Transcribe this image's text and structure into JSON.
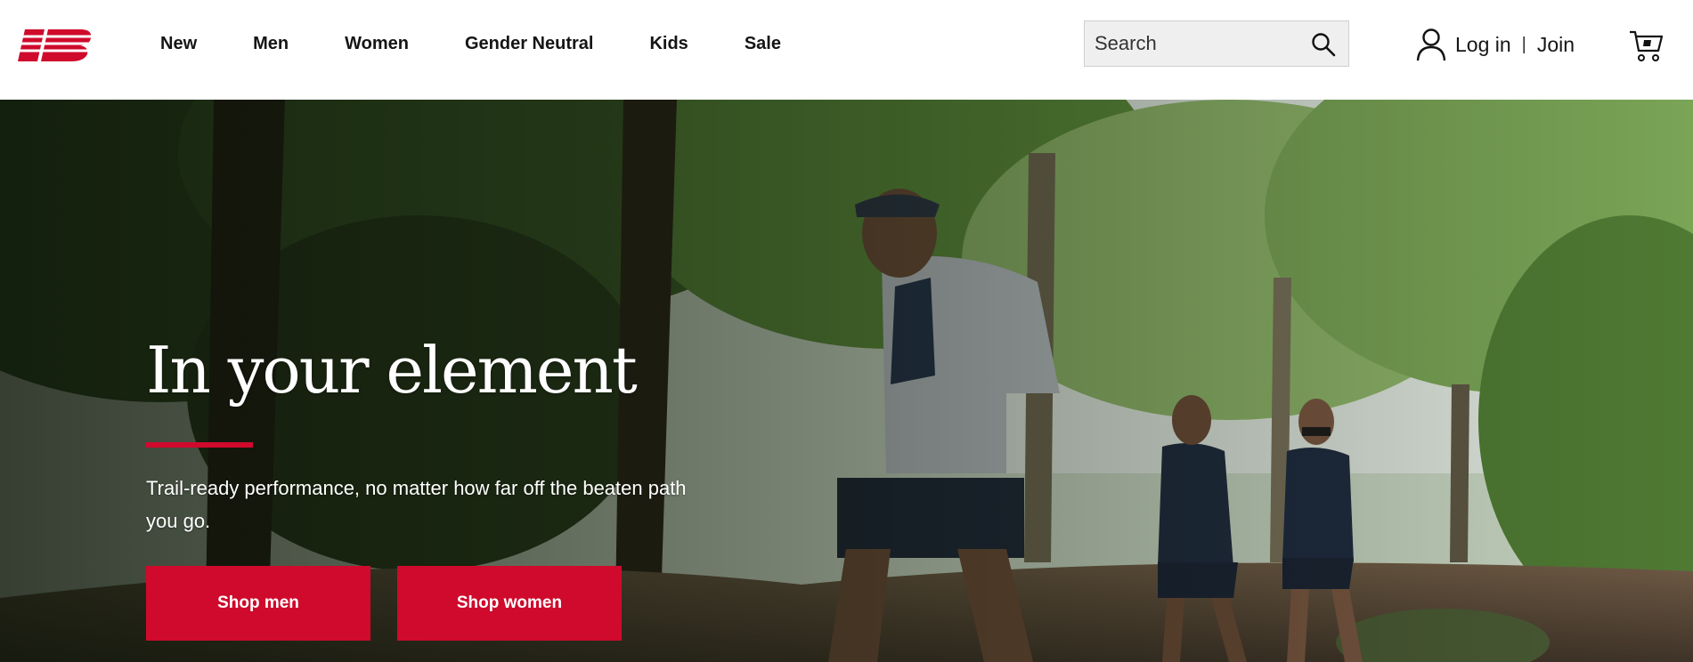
{
  "brand": {
    "logo": "NB",
    "accent_color": "#cf0a2c"
  },
  "nav": {
    "items": [
      {
        "label": "New"
      },
      {
        "label": "Men"
      },
      {
        "label": "Women"
      },
      {
        "label": "Gender Neutral"
      },
      {
        "label": "Kids"
      },
      {
        "label": "Sale"
      }
    ]
  },
  "search": {
    "placeholder": "Search",
    "icon": "search-icon"
  },
  "account": {
    "login_label": "Log in",
    "separator": "|",
    "join_label": "Join",
    "icon": "user-icon"
  },
  "cart": {
    "icon": "cart-icon"
  },
  "hero": {
    "title": "In your element",
    "subtitle": "Trail-ready performance, no matter how far off the beaten path you go.",
    "buttons": [
      {
        "label": "Shop men"
      },
      {
        "label": "Shop women"
      }
    ]
  }
}
